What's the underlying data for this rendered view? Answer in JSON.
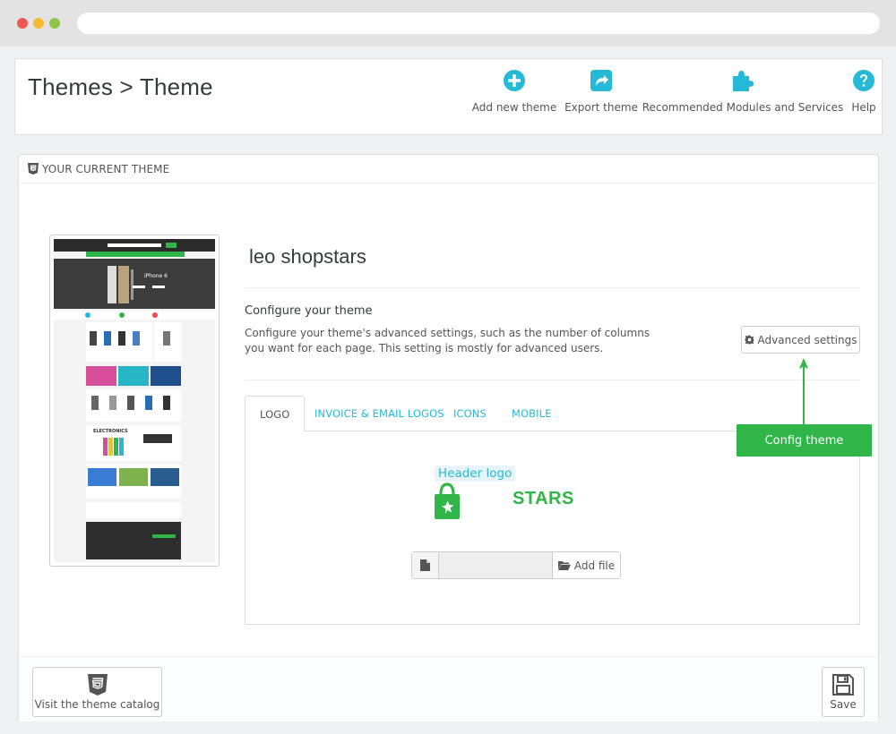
{
  "header": {
    "title": "Themes > Theme",
    "toolbar": [
      {
        "label": "Add new theme",
        "icon": "plus-circle-icon"
      },
      {
        "label": "Export theme",
        "icon": "share-icon"
      },
      {
        "label": "Recommended Modules and Services",
        "icon": "puzzle-icon"
      },
      {
        "label": "Help",
        "icon": "help-icon"
      }
    ]
  },
  "panel": {
    "heading": "YOUR CURRENT THEME",
    "theme_name": "leo shopstars",
    "configure": {
      "title": "Configure your theme",
      "description": "Configure your theme's advanced settings, such as the number of columns you want for each page. This setting is mostly for advanced users.",
      "advanced_button": "Advanced settings"
    },
    "tabs": [
      "LOGO",
      "INVOICE & EMAIL LOGOS",
      "ICONS",
      "MOBILE"
    ],
    "active_tab": "LOGO",
    "logo": {
      "caption": "Header logo",
      "brand_text": "STARS",
      "add_file": "Add file"
    },
    "thumbnail": {
      "hero_text": "iPhone 6",
      "banner_text": "ELECTRONICS"
    },
    "footer": {
      "catalog_button": "Visit the theme catalog",
      "save_button": "Save"
    }
  },
  "annotation": {
    "label": "Config theme"
  },
  "colors": {
    "accent": "#25b9d7",
    "callout_green": "#2fb548",
    "title_text": "#363a41"
  }
}
